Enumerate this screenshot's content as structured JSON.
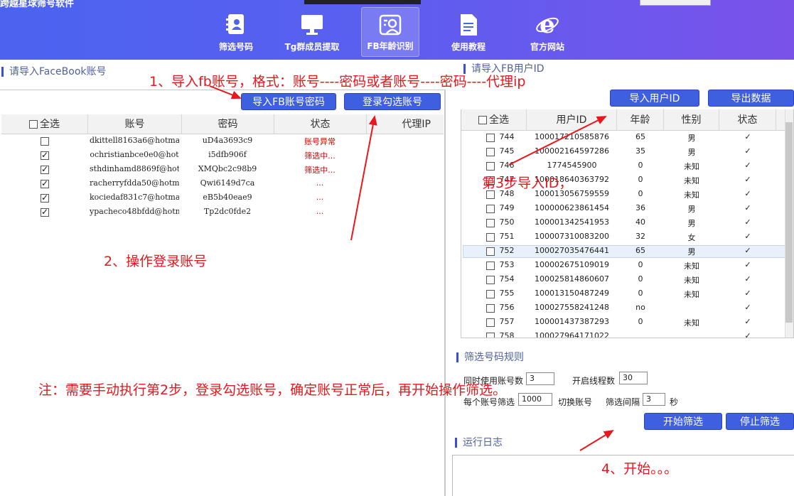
{
  "app": {
    "title": "跨越星球筛号软件"
  },
  "nav": [
    {
      "label": "筛选号码",
      "icon": "contacts-icon"
    },
    {
      "label": "Tg群成员提取",
      "icon": "monitor-icon"
    },
    {
      "label": "FB年龄识别",
      "icon": "face-scan-icon"
    },
    {
      "label": "使用教程",
      "icon": "document-icon"
    },
    {
      "label": "官方网站",
      "icon": "browser-e-icon"
    }
  ],
  "left": {
    "section_title": "请导入FaceBook账号",
    "import_button": "导入FB账号密码",
    "login_button": "登录勾选账号",
    "columns": [
      "全选",
      "账号",
      "密码",
      "状态",
      "代理IP"
    ],
    "rows": [
      {
        "checked": false,
        "account": "dkittell8163a6@hotma",
        "password": "uD4a3693c9",
        "status": "账号异常"
      },
      {
        "checked": true,
        "account": "ochristianbce0e0@hot",
        "password": "i5dfb906f",
        "status": "筛选中..."
      },
      {
        "checked": true,
        "account": "sthdinhamd8869f@hotm",
        "password": "XMQbc2c98b9",
        "status": "筛选中..."
      },
      {
        "checked": true,
        "account": "racherryfdda50@hotma",
        "password": "Qwi6149d7ca",
        "status": "..."
      },
      {
        "checked": true,
        "account": "kociedaf831c7@hotmai",
        "password": "eB5b40eae9",
        "status": "..."
      },
      {
        "checked": true,
        "account": "ypacheco48bfdd@hotma",
        "password": "Tp2dc0fde2",
        "status": "..."
      }
    ]
  },
  "right": {
    "section_title": "请导入FB用户ID",
    "import_button": "导入用户ID",
    "export_button": "导出数据",
    "columns": [
      "全选",
      "用户ID",
      "年龄",
      "性别",
      "状态"
    ],
    "rows": [
      {
        "num": "744",
        "uid": "100017210585876",
        "age": "65",
        "gender": "男",
        "status": "✓"
      },
      {
        "num": "745",
        "uid": "100002164597286",
        "age": "35",
        "gender": "男",
        "status": "✓"
      },
      {
        "num": "746",
        "uid": "1774545900",
        "age": "0",
        "gender": "未知",
        "status": "✓"
      },
      {
        "num": "747",
        "uid": "100018640363792",
        "age": "0",
        "gender": "未知",
        "status": "✓"
      },
      {
        "num": "748",
        "uid": "100013056759559",
        "age": "0",
        "gender": "未知",
        "status": "✓"
      },
      {
        "num": "749",
        "uid": "100000623861454",
        "age": "36",
        "gender": "男",
        "status": "✓"
      },
      {
        "num": "750",
        "uid": "100001342541953",
        "age": "40",
        "gender": "男",
        "status": "✓"
      },
      {
        "num": "751",
        "uid": "100007310083200",
        "age": "32",
        "gender": "女",
        "status": "✓"
      },
      {
        "num": "752",
        "uid": "100027035476441",
        "age": "65",
        "gender": "男",
        "status": "✓"
      },
      {
        "num": "753",
        "uid": "100002675109019",
        "age": "0",
        "gender": "未知",
        "status": "✓"
      },
      {
        "num": "754",
        "uid": "100025814860607",
        "age": "0",
        "gender": "未知",
        "status": "✓"
      },
      {
        "num": "755",
        "uid": "100013150487249",
        "age": "0",
        "gender": "未知",
        "status": "✓"
      },
      {
        "num": "756",
        "uid": "100027558241248",
        "age": "no",
        "gender": "",
        "status": "✓"
      },
      {
        "num": "757",
        "uid": "100001437387293",
        "age": "0",
        "gender": "未知",
        "status": "✓"
      },
      {
        "num": "758",
        "uid": "100027964171022",
        "age": "",
        "gender": "",
        "status": "✓"
      }
    ],
    "highlighted_row": "752"
  },
  "rules": {
    "section_title": "筛选号码规则",
    "concurrent_label": "同时使用账号数",
    "concurrent_value": "3",
    "threads_label": "开启线程数",
    "threads_value": "30",
    "per_account_label": "每个账号筛选",
    "per_account_value": "1000",
    "switch_label": "切换账号",
    "interval_label": "筛选间隔",
    "interval_value": "3",
    "interval_unit": "秒",
    "start_button": "开始筛选",
    "stop_button": "停止筛选"
  },
  "log": {
    "section_title": "运行日志"
  },
  "annotations": {
    "step1": "1、导入fb账号，格式：账号----密码或者账号----密码----代理ip",
    "step2": "2、操作登录账号",
    "step3": "第3步导入ID，",
    "step4": "4、开始。。。",
    "note": "注：需要手动执行第2步，登录勾选账号，确定账号正常后，再开始操作筛选。"
  },
  "colors": {
    "header_start": "#4b63f0",
    "header_end": "#7a52ea",
    "button": "#3d5fe0",
    "annotation": "#e8161d",
    "status_error": "#cc0000"
  }
}
